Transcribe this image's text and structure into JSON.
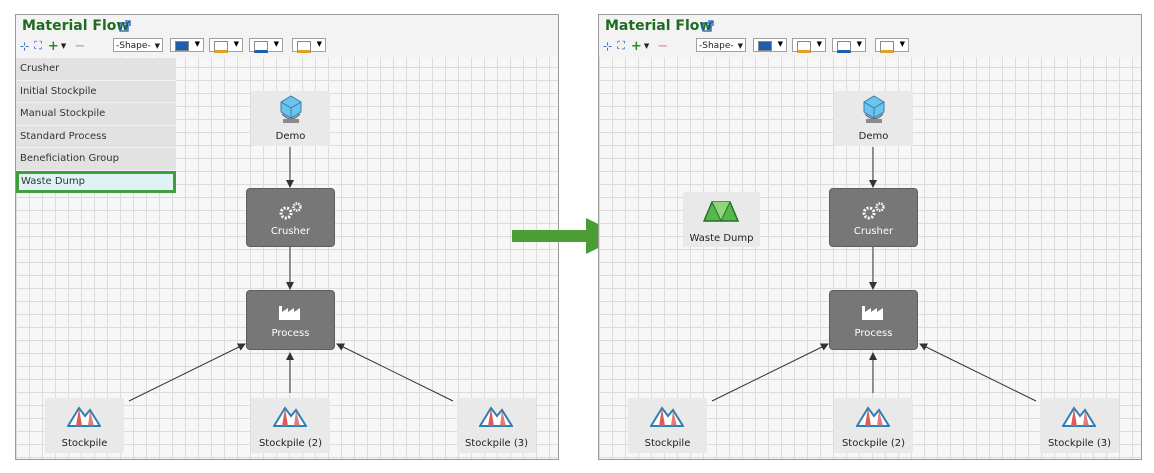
{
  "panels": {
    "before": {
      "title": "Material Flow",
      "shape_select": "-Shape-",
      "menu": [
        "Crusher",
        "Initial Stockpile",
        "Manual Stockpile",
        "Standard Process",
        "Beneficiation Group",
        "Waste Dump"
      ],
      "selected_menu_item": "Waste Dump",
      "nodes": {
        "demo": "Demo",
        "crusher": "Crusher",
        "process": "Process",
        "stockpile1": "Stockpile",
        "stockpile2": "Stockpile (2)",
        "stockpile3": "Stockpile (3)"
      }
    },
    "after": {
      "title": "Material Flow",
      "shape_select": "-Shape-",
      "nodes": {
        "waste": "Waste Dump",
        "demo": "Demo",
        "crusher": "Crusher",
        "process": "Process",
        "stockpile1": "Stockpile",
        "stockpile2": "Stockpile (2)",
        "stockpile3": "Stockpile (3)"
      }
    }
  },
  "colors": {
    "title": "#1f6b22",
    "process_node": "#777777",
    "arrow": "#4a9e35",
    "selection": "#3f9f3a"
  },
  "icons": {
    "demo": "diamond-bowl-icon",
    "crusher": "gears-icon",
    "process": "factory-icon",
    "stockpile": "mountain-icon",
    "waste": "waste-dump-icon"
  }
}
